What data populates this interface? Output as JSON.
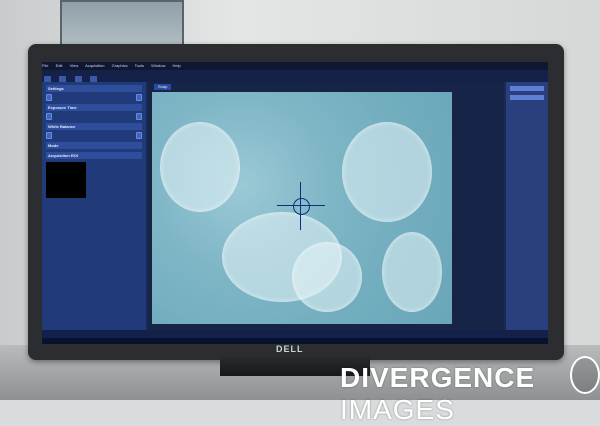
{
  "screen": {
    "menubar": [
      "File",
      "Edit",
      "View",
      "Acquisition",
      "Graphics",
      "Tools",
      "Window",
      "Help"
    ],
    "left_panel_sections": [
      {
        "title": "Settings"
      },
      {
        "title": "Exposure Time"
      },
      {
        "title": "White Balance"
      },
      {
        "title": "Mode"
      },
      {
        "title": "Acquisition ROI"
      }
    ],
    "image_tab_label": "Snap"
  },
  "monitor": {
    "brand": "DELL"
  },
  "watermark": {
    "text_main": "DIVERGENCE",
    "text_thin": "IMAGES"
  },
  "colors": {
    "micro_bg": "#7fb6c6",
    "ui_panel": "#213a7a",
    "accent": "#3f64c0"
  }
}
